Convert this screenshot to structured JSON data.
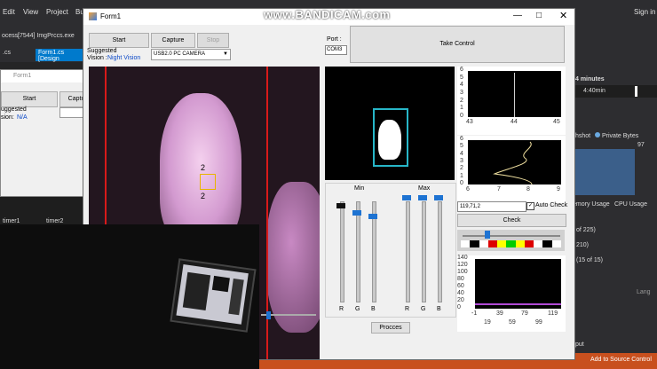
{
  "ide": {
    "menu": [
      "Edit",
      "View",
      "Project",
      "Bu"
    ],
    "sign_in": "Sign in",
    "process_label": "ocess:",
    "process_value": "[7544] ImgPrccs.exe",
    "tab1": ".cs",
    "tab2": "Form1.cs [Design",
    "timer1": "timer1",
    "timer2": "timer2",
    "minutes": "4 minutes",
    "time": "4:40min",
    "snapshot": "hshot",
    "private_bytes": "Private Bytes",
    "value97": "97",
    "memory_usage": "emory Usage",
    "cpu_usage": "CPU Usage",
    "of225": "of 225)",
    "n210": "210)",
    "of15": "(15 of 15)",
    "lang": "Lang",
    "out": "put",
    "add_to_source": "Add to Source Control"
  },
  "watermark": "www.BANDICAM.com",
  "inner_form": {
    "title": "Form1",
    "start": "Start",
    "capture": "Captu",
    "suggested": "uggested",
    "vision": "sion:",
    "na": "N/A"
  },
  "form": {
    "title": "Form1",
    "start": "Start",
    "capture": "Capture",
    "stop": "Stop",
    "port_label": "Port :",
    "port_value": "COM3",
    "take_control": "Take Control",
    "suggested": "Suggested",
    "vision": "Vision :",
    "vision_value": "Night Vision",
    "camera_select": "USB2.0 PC CAMERA",
    "detected_top": "2",
    "detected_bottom": "2",
    "min_label": "Min",
    "max_label": "Max",
    "r": "R",
    "g": "G",
    "b": "B",
    "procces": "Procces",
    "coord_value": "119,71,2",
    "auto_check": "Auto Check",
    "check": "Check",
    "hist1_y": [
      "6",
      "5",
      "4",
      "3",
      "2",
      "1",
      "0"
    ],
    "hist1_x": [
      "43",
      "44",
      "45"
    ],
    "hist2_y": [
      "6",
      "5",
      "4",
      "3",
      "2",
      "1",
      "0"
    ],
    "hist2_x": [
      "6",
      "7",
      "8",
      "9"
    ],
    "hist3_y": [
      "140",
      "120",
      "100",
      "80",
      "60",
      "40",
      "20",
      "0"
    ],
    "hist3_x_top": [
      "-1",
      "39",
      "79",
      "119"
    ],
    "hist3_x_bottom": [
      "19",
      "59",
      "99"
    ]
  },
  "colors": {
    "accent": "#1e73d2",
    "status_bar": "#c8501e",
    "red_line": "#d91a1a",
    "tracker_box": "#e8b400",
    "mask_border": "#27b6c8"
  }
}
